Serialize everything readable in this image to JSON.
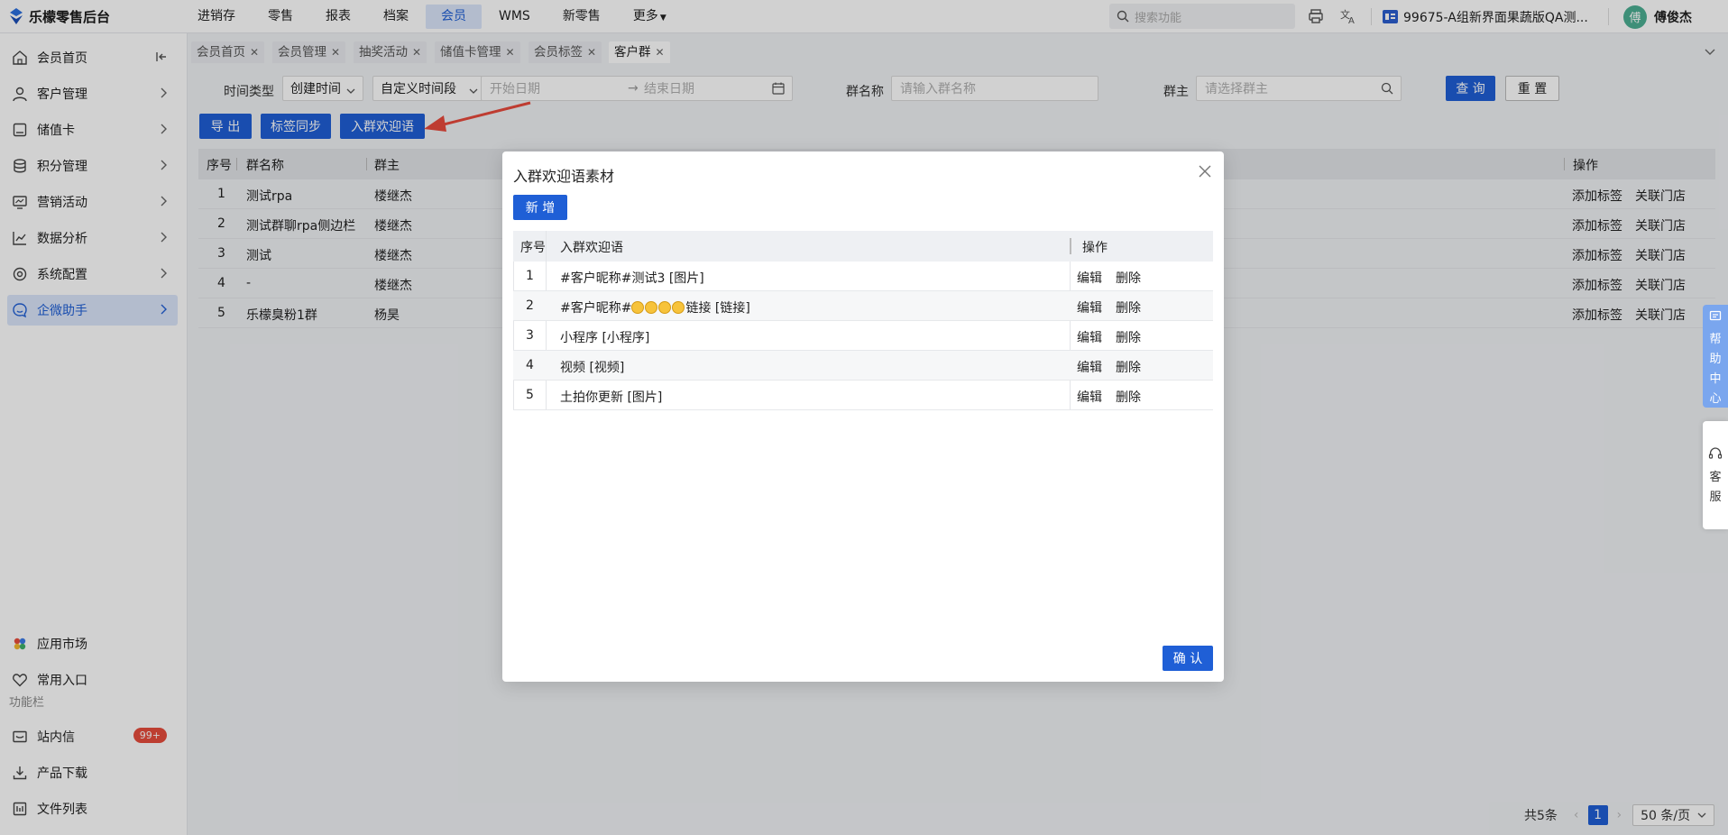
{
  "app": {
    "title": "乐檬零售后台"
  },
  "topnav": [
    "进销存",
    "零售",
    "报表",
    "档案",
    "会员",
    "WMS",
    "新零售",
    "更多"
  ],
  "topnav_active": 4,
  "search": {
    "placeholder": "搜索功能"
  },
  "store": {
    "label": "99675-A组新界面果蔬版QA测..."
  },
  "user": {
    "avatar_char": "傅",
    "name": "傅俊杰"
  },
  "sidebar": {
    "items": [
      {
        "label": "会员首页",
        "icon": "home-icon"
      },
      {
        "label": "客户管理",
        "icon": "user-icon"
      },
      {
        "label": "储值卡",
        "icon": "card-icon"
      },
      {
        "label": "积分管理",
        "icon": "database-icon"
      },
      {
        "label": "营销活动",
        "icon": "monitor-icon"
      },
      {
        "label": "数据分析",
        "icon": "chart-icon"
      },
      {
        "label": "系统配置",
        "icon": "gear-icon"
      },
      {
        "label": "企微助手",
        "icon": "chat-icon"
      }
    ],
    "bottom": [
      {
        "label": "应用市场",
        "icon": "apps-icon"
      },
      {
        "label": "常用入口",
        "icon": "heart-icon"
      }
    ],
    "section_label": "功能栏",
    "tools": [
      {
        "label": "站内信",
        "icon": "mail-icon",
        "badge": "99+"
      },
      {
        "label": "产品下载",
        "icon": "download-icon"
      },
      {
        "label": "文件列表",
        "icon": "file-list-icon"
      }
    ]
  },
  "tabs": [
    "会员首页",
    "会员管理",
    "抽奖活动",
    "储值卡管理",
    "会员标签",
    "客户群"
  ],
  "filters": {
    "time_type_label": "时间类型",
    "time_type_value": "创建时间",
    "range_value": "自定义时间段",
    "start_placeholder": "开始日期",
    "end_placeholder": "结束日期",
    "group_name_label": "群名称",
    "group_name_placeholder": "请输入群名称",
    "owner_label": "群主",
    "owner_placeholder": "请选择群主",
    "query": "查 询",
    "reset": "重 置"
  },
  "actions": {
    "export": "导 出",
    "tag_sync": "标签同步",
    "welcome": "入群欢迎语"
  },
  "table": {
    "headers": {
      "index": "序号",
      "name": "群名称",
      "owner": "群主",
      "ops": "操作"
    },
    "rows": [
      {
        "index": "1",
        "name": "测试rpa",
        "owner": "楼继杰",
        "op1": "添加标签",
        "op2": "关联门店"
      },
      {
        "index": "2",
        "name": "测试群聊rpa侧边栏",
        "owner": "楼继杰",
        "op1": "添加标签",
        "op2": "关联门店"
      },
      {
        "index": "3",
        "name": "测试",
        "owner": "楼继杰",
        "op1": "添加标签",
        "op2": "关联门店"
      },
      {
        "index": "4",
        "name": "-",
        "owner": "楼继杰",
        "op1": "添加标签",
        "op2": "关联门店"
      },
      {
        "index": "5",
        "name": "乐檬臭粉1群",
        "owner": "杨昊",
        "op1": "添加标签",
        "op2": "关联门店"
      }
    ]
  },
  "pager": {
    "total": "共5条",
    "current": "1",
    "page_size": "50 条/页"
  },
  "modal": {
    "title": "入群欢迎语素材",
    "add": "新 增",
    "headers": {
      "index": "序号",
      "text": "入群欢迎语",
      "ops": "操作"
    },
    "rows": [
      {
        "index": "1",
        "text": "#客户昵称#测试3 [图片]",
        "edit": "编辑",
        "del": "删除"
      },
      {
        "index": "2",
        "text_prefix": "#客户昵称#",
        "emoji_count": 4,
        "text_suffix": "链接 [链接]",
        "edit": "编辑",
        "del": "删除"
      },
      {
        "index": "3",
        "text": "小程序 [小程序]",
        "edit": "编辑",
        "del": "删除"
      },
      {
        "index": "4",
        "text": "视频 [视频]",
        "edit": "编辑",
        "del": "删除"
      },
      {
        "index": "5",
        "text": "土拍你更新 [图片]",
        "edit": "编辑",
        "del": "删除"
      }
    ],
    "ok": "确 认"
  },
  "help": {
    "chars": [
      "帮",
      "助",
      "中",
      "心"
    ]
  },
  "service": {
    "chars": [
      "客",
      "服"
    ]
  },
  "colors": {
    "primary": "#1f5fd6",
    "link": "#2060d6",
    "active_bg": "#dbe6fb",
    "badge": "#e74c3c",
    "arrow": "#e84a3c"
  }
}
